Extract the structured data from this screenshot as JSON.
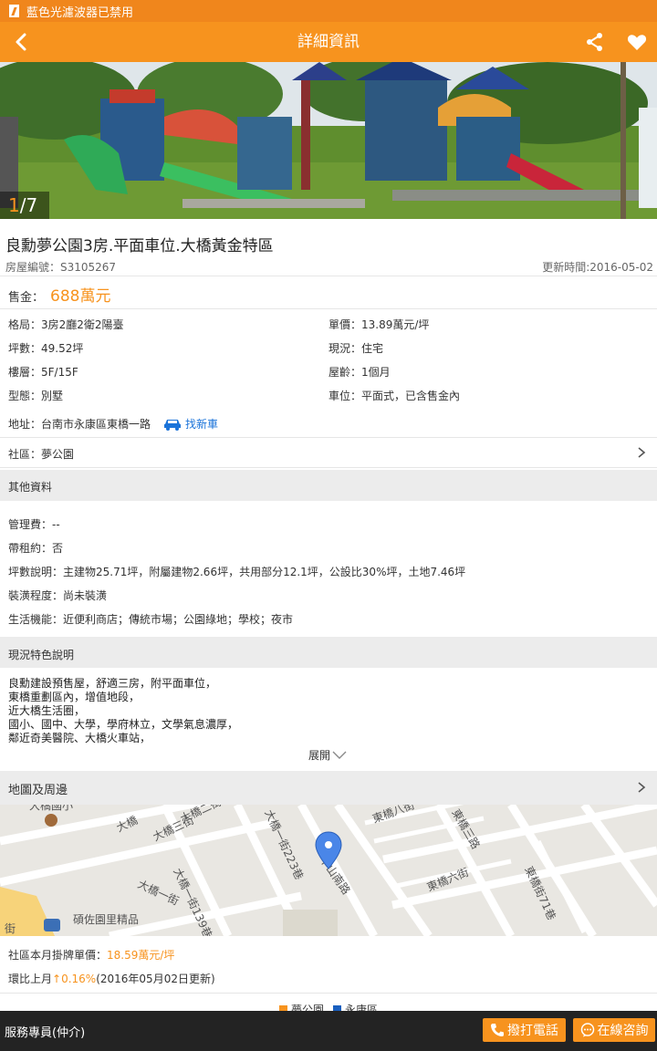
{
  "status_bar": {
    "text": "藍色光濾波器已禁用"
  },
  "app_bar": {
    "title": "詳細資訊",
    "back_icon": "back-arrow-icon",
    "share_icon": "share-icon",
    "favorite_icon": "heart-icon"
  },
  "photo": {
    "current": "1",
    "separator_total": "/7"
  },
  "listing": {
    "title": "良勳夢公園3房.平面車位.大橋黃金特區",
    "id_label": "房屋編號：S3105267",
    "updated": "更新時間:2016-05-02",
    "price_label": "售金：",
    "price_value": "688萬元",
    "specs_left": [
      "格局：3房2廳2衛2陽臺",
      "坪數：49.52坪",
      "樓層：5F/15F",
      "型態：別墅"
    ],
    "specs_right": [
      "單價：13.89萬元/坪",
      "現況：住宅",
      "屋齡：1個月",
      "車位：平面式，已含售金內"
    ],
    "address": "地址：台南市永康區東橋一路",
    "find_car": "找新車",
    "community": "社區：夢公園"
  },
  "other_info": {
    "header": "其他資料",
    "items": [
      "管理費：--",
      "帶租約：否",
      "坪數說明：主建物25.71坪，附屬建物2.66坪，共用部分12.1坪，公設比30%坪，土地7.46坪",
      "裝潢程度：尚未裝潢",
      "生活機能：近便利商店；傳統市場；公園綠地；學校；夜市"
    ]
  },
  "features": {
    "header": "現況特色說明",
    "lines": [
      "良勳建設預售屋，舒適三房，附平面車位，",
      "東橋重劃區內，增值地段，",
      "近大橋生活圈，",
      "國小、國中、大學，學府林立，文學氣息濃厚，",
      "鄰近奇美醫院、大橋火車站，"
    ],
    "expand_label": "展開"
  },
  "map_section": {
    "header": "地圖及周邊",
    "labels": [
      "大橋國小",
      "大橋二街",
      "大橋三街",
      "大橋一街223巷",
      "中山南路",
      "東橋八街",
      "東橋三路",
      "東橋六街",
      "東橋街71巷",
      "大橋一街139巷",
      "大橋一街",
      "大橋",
      "碩佐園里精品",
      "街"
    ]
  },
  "stats": {
    "avg_label": "社區本月掛牌單價：",
    "avg_value": "18.59萬元/坪",
    "mom_label": "環比上月",
    "mom_value": "↑0.16%",
    "mom_suffix": "(2016年05月02日更新)"
  },
  "legend": {
    "items": [
      "夢公園",
      "永康區"
    ],
    "colors": [
      "#f7931e",
      "#1a5fbf"
    ]
  },
  "bottom_bar": {
    "agent_label": "服務專員(仲介)",
    "call_button": "撥打電話",
    "chat_button": "在線咨詢"
  }
}
